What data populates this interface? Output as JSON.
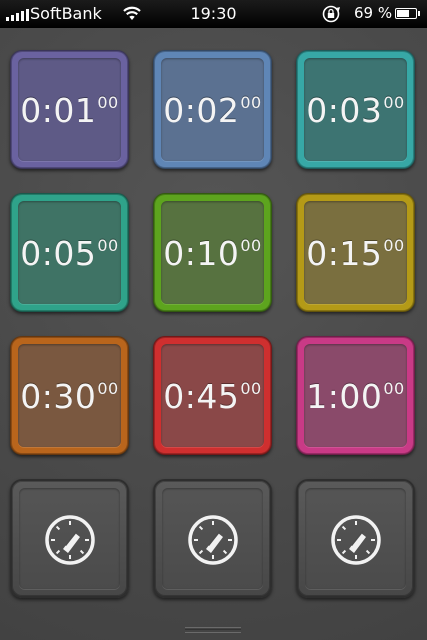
{
  "status_bar": {
    "carrier": "SoftBank",
    "time": "19:30",
    "battery": "69 %"
  },
  "timers": [
    {
      "main": "0:01",
      "sup": "00",
      "color": "#5e5a86",
      "border": "#6a62a0"
    },
    {
      "main": "0:02",
      "sup": "00",
      "color": "#5b7191",
      "border": "#5f86b6"
    },
    {
      "main": "0:03",
      "sup": "00",
      "color": "#3d7472",
      "border": "#37a8a6"
    },
    {
      "main": "0:05",
      "sup": "00",
      "color": "#3f7365",
      "border": "#2fa38a"
    },
    {
      "main": "0:10",
      "sup": "00",
      "color": "#577240",
      "border": "#5da41e"
    },
    {
      "main": "0:15",
      "sup": "00",
      "color": "#7a6f3f",
      "border": "#b49a17"
    },
    {
      "main": "0:30",
      "sup": "00",
      "color": "#7a5840",
      "border": "#b9651c"
    },
    {
      "main": "0:45",
      "sup": "00",
      "color": "#8a4848",
      "border": "#cf2f2f"
    },
    {
      "main": "1:00",
      "sup": "00",
      "color": "#8a4a6a",
      "border": "#c93a86"
    }
  ],
  "stopwatches": [
    {
      "icon": "stopwatch-icon"
    },
    {
      "icon": "stopwatch-icon"
    },
    {
      "icon": "stopwatch-icon"
    }
  ]
}
